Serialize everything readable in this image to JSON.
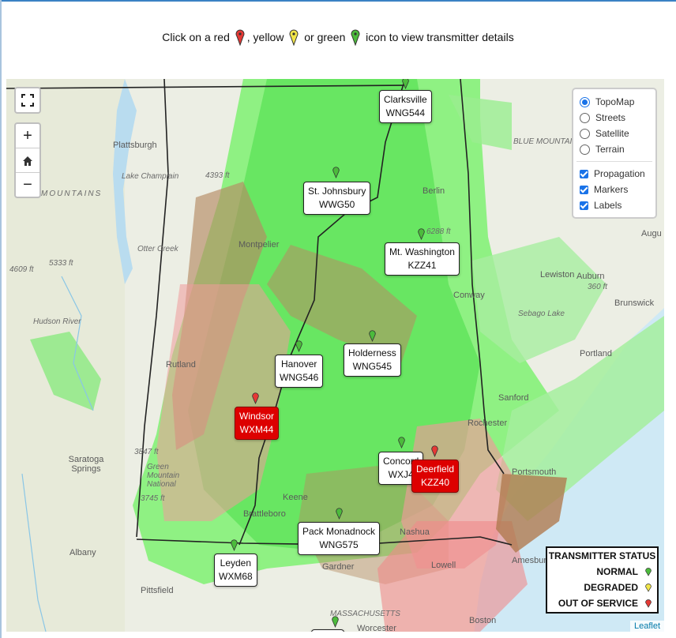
{
  "instructions": {
    "prefix": "Click on a red",
    "mid1": ", yellow",
    "mid2": "or green",
    "suffix": "icon to view transmitter details"
  },
  "colors": {
    "normal": "#4cbb3c",
    "degraded": "#f1e54a",
    "out": "#e53935",
    "label_red": "#dd0000"
  },
  "controls": {
    "fullscreen_icon": "fullscreen-icon",
    "zoom_in": "+",
    "home_icon": "home-icon",
    "zoom_out": "−"
  },
  "layers": {
    "base": [
      "TopoMap",
      "Streets",
      "Satellite",
      "Terrain"
    ],
    "selected_base": "TopoMap",
    "overlays": [
      "Propagation",
      "Markers",
      "Labels"
    ]
  },
  "transmitters": [
    {
      "name": "Clarksville",
      "call": "WNG544",
      "status": "normal"
    },
    {
      "name": "St. Johnsbury",
      "call": "WWG50",
      "status": "normal"
    },
    {
      "name": "Mt. Washington",
      "call": "KZZ41",
      "status": "normal"
    },
    {
      "name": "Hanover",
      "call": "WNG546",
      "status": "normal"
    },
    {
      "name": "Holderness",
      "call": "WNG545",
      "status": "normal"
    },
    {
      "name": "Windsor",
      "call": "WXM44",
      "status": "out"
    },
    {
      "name": "Concord",
      "call": "WXJ4",
      "status": "normal"
    },
    {
      "name": "Deerfield",
      "call": "KZZ40",
      "status": "out"
    },
    {
      "name": "Pack Monadnock",
      "call": "WNG575",
      "status": "normal"
    },
    {
      "name": "Leyden",
      "call": "WXM68",
      "status": "normal"
    }
  ],
  "towns": [
    "Plattsburgh",
    "Lake Champlain",
    "Berlin",
    "Montpelier",
    "Lewiston",
    "Auburn",
    "Augu",
    "Rutland",
    "Saratoga Springs",
    "Albany",
    "Pittsfield",
    "Sanford",
    "Rochester",
    "Portsmouth",
    "Conway",
    "Sebago Lake",
    "Portland",
    "Hudson River",
    "Otter Creek",
    "Brattleboro",
    "Keene",
    "Green Mountain National",
    "Worcester",
    "MASSACHUSETTS",
    "Brunswick",
    "Boston",
    "Gardner",
    "Nashua",
    "Lowell",
    "Amesbury",
    "BLUE MOUNTAIN",
    "MOUNTAINS"
  ],
  "elevations": [
    "5333 ft",
    "4609 ft",
    "3847 ft",
    "3745 ft",
    "4393 ft",
    "6288 ft",
    "360 ft"
  ],
  "legend": {
    "title": "TRANSMITTER STATUS",
    "rows": [
      {
        "label": "NORMAL",
        "status": "normal"
      },
      {
        "label": "DEGRADED",
        "status": "degraded"
      },
      {
        "label": "OUT OF SERVICE",
        "status": "out"
      }
    ]
  },
  "attribution": "Leaflet"
}
